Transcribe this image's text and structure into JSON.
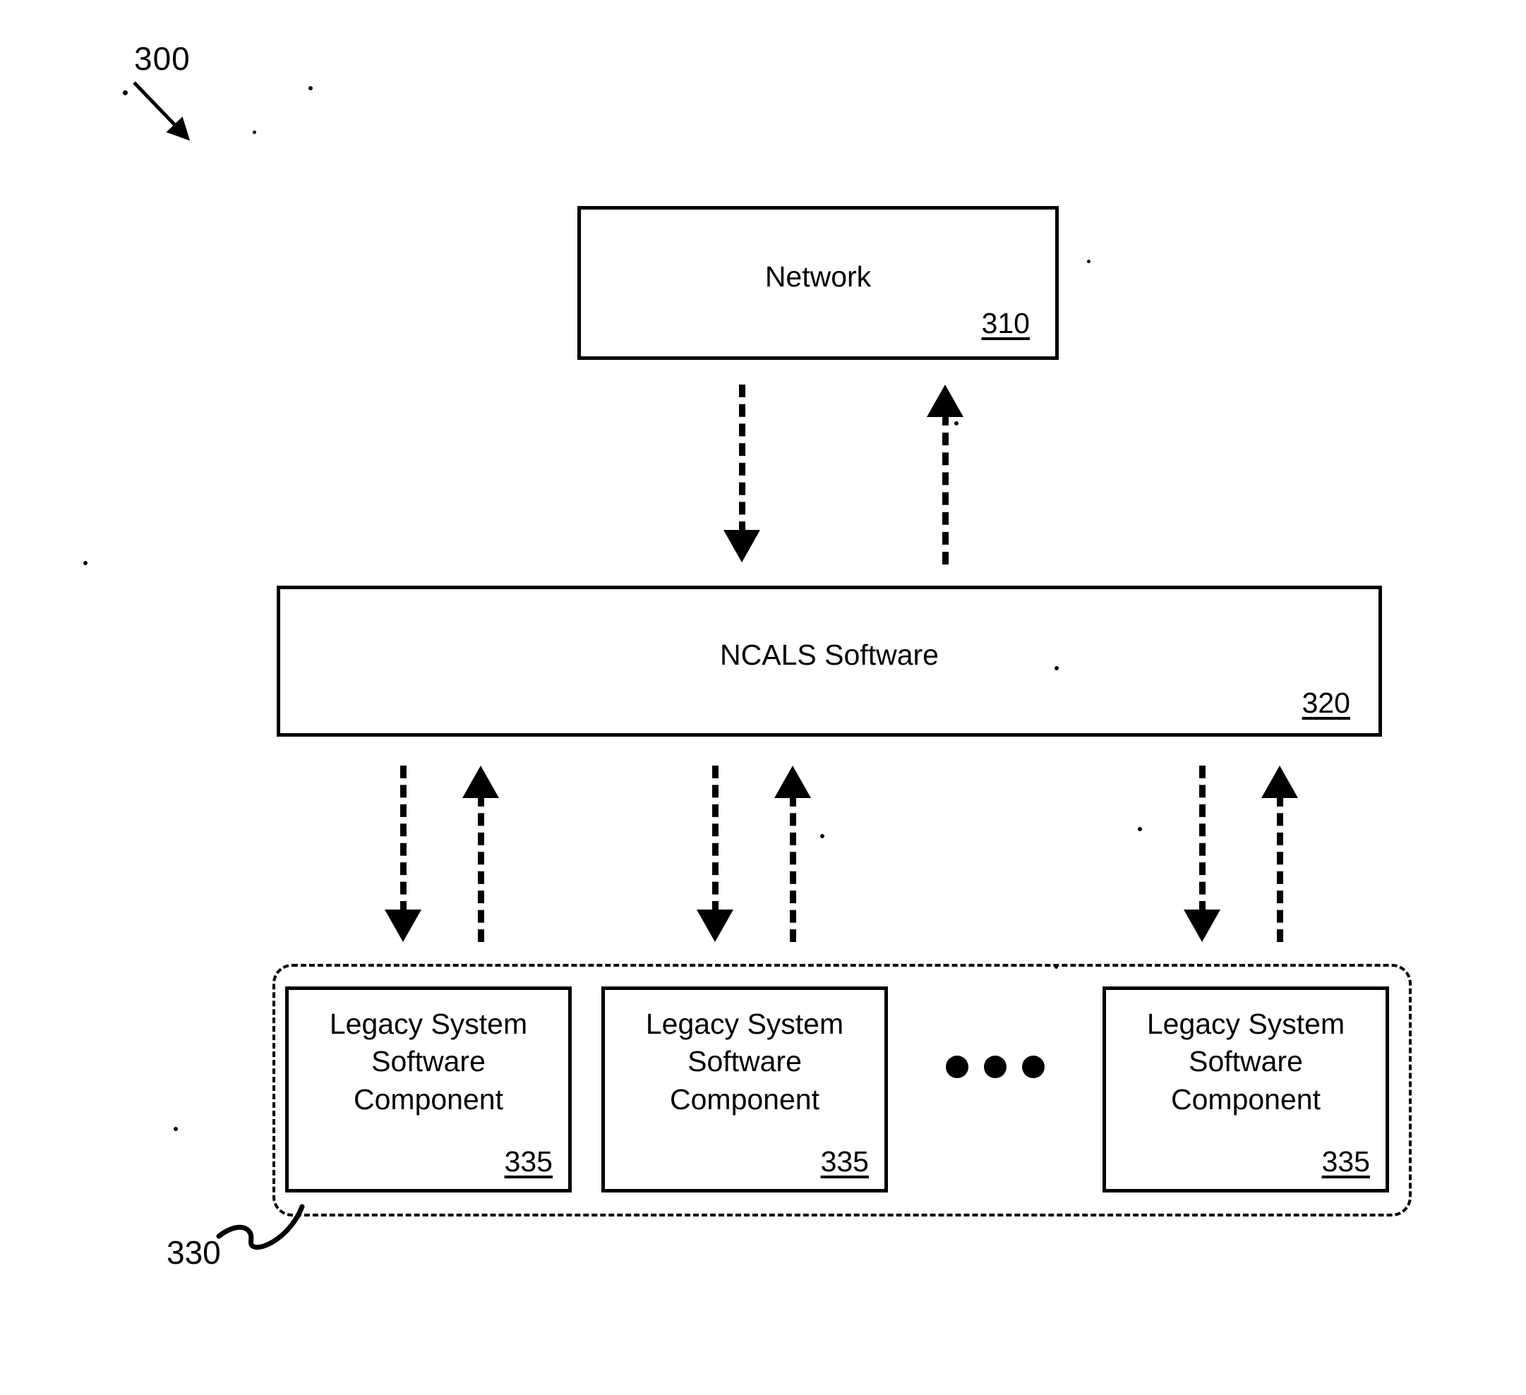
{
  "figure": {
    "number": "300",
    "group_ref": "330"
  },
  "nodes": {
    "network": {
      "title": "Network",
      "ref": "310"
    },
    "ncals": {
      "title": "NCALS Software",
      "ref": "320"
    },
    "legacy_components": [
      {
        "title": "Legacy System Software Component",
        "ref": "335"
      },
      {
        "title": "Legacy System Software Component",
        "ref": "335"
      },
      {
        "title": "Legacy System Software Component",
        "ref": "335"
      }
    ]
  },
  "ellipsis": "•••",
  "colors": {
    "stroke": "#000000",
    "background": "#ffffff"
  }
}
